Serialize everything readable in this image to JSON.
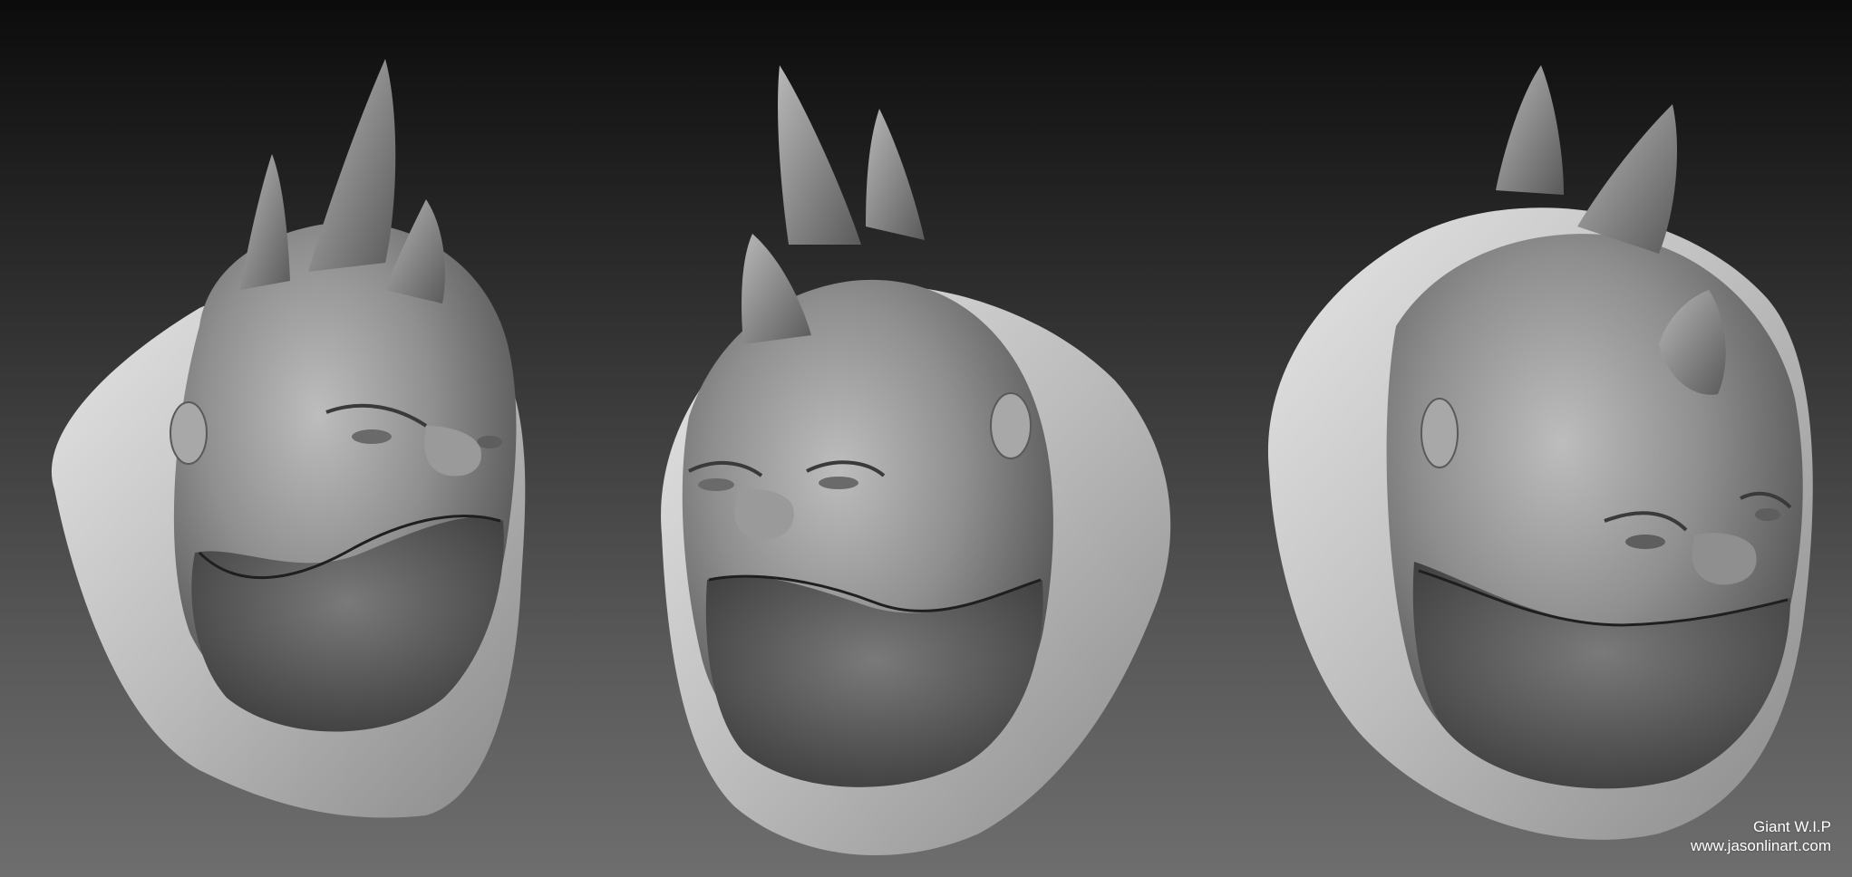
{
  "caption": {
    "title": "Giant W.I.P",
    "website": "www.jasonlinart.com"
  },
  "colors": {
    "background_top": "#0c0c0c",
    "background_bottom": "#6e6e6e",
    "clay_light": "#d4d4d4",
    "clay_dark": "#4a4a4a",
    "caption_text": "#ffffff"
  }
}
